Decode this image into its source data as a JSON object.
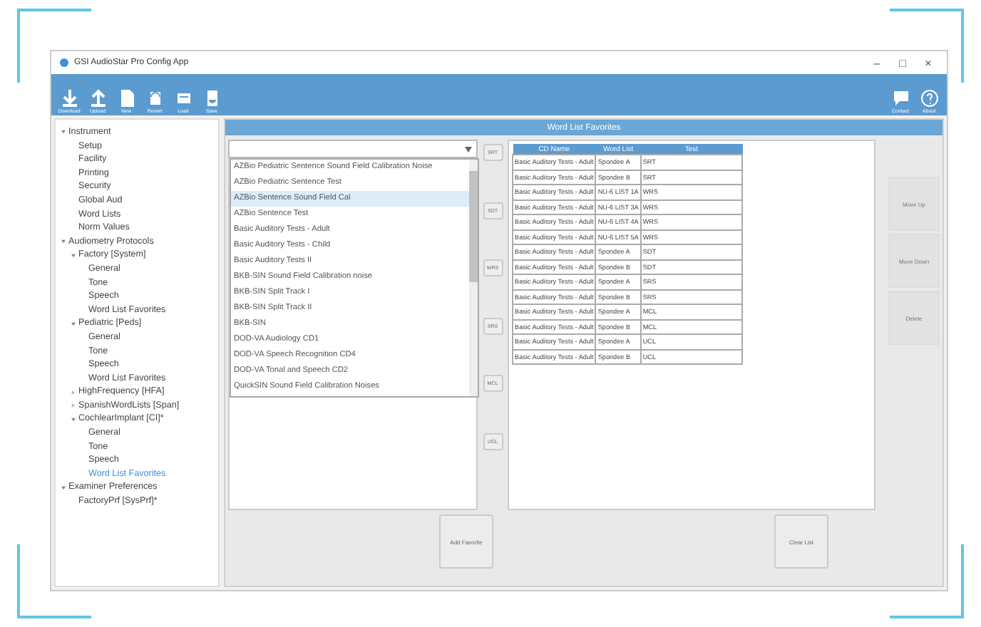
{
  "window": {
    "title": "GSI AudioStar Pro Config App",
    "controls": [
      "–",
      "□",
      "×"
    ]
  },
  "toolbar": {
    "buttons": [
      {
        "label": "Download"
      },
      {
        "label": "Upload"
      },
      {
        "label": "New"
      },
      {
        "label": "Revert"
      },
      {
        "label": "Load"
      },
      {
        "label": "Save"
      }
    ],
    "right_buttons": [
      {
        "label": "Contact"
      },
      {
        "label": "About"
      }
    ]
  },
  "sidebar": {
    "tree": [
      {
        "label": "Instrument",
        "expanded": true,
        "selected": false,
        "children": [
          {
            "label": "Setup",
            "selected": false
          },
          {
            "label": "Facility",
            "selected": false
          },
          {
            "label": "Printing",
            "selected": false
          },
          {
            "label": "Security",
            "selected": false
          },
          {
            "label": "Global Aud",
            "selected": false
          },
          {
            "label": "Word Lists",
            "selected": false
          },
          {
            "label": "Norm Values",
            "selected": false
          }
        ]
      },
      {
        "label": "Audiometry Protocols",
        "expanded": true,
        "selected": false,
        "children": [
          {
            "label": "Factory [System]",
            "expanded": true,
            "selected": false,
            "children": [
              {
                "label": "General",
                "selected": false
              },
              {
                "label": "Tone",
                "selected": false
              },
              {
                "label": "Speech",
                "selected": false
              },
              {
                "label": "Word List Favorites",
                "selected": false
              }
            ]
          },
          {
            "label": "Pediatric [Peds]",
            "expanded": true,
            "selected": false,
            "children": [
              {
                "label": "General",
                "selected": false
              },
              {
                "label": "Tone",
                "selected": false
              },
              {
                "label": "Speech",
                "selected": false
              },
              {
                "label": "Word List Favorites",
                "selected": false
              }
            ]
          },
          {
            "label": "HighFrequency [HFA]",
            "expanded": false,
            "selected": false
          },
          {
            "label": "SpanishWordLists [Span]",
            "expanded": false,
            "selected": false
          },
          {
            "label": "CochlearImplant [CI]*",
            "expanded": true,
            "selected": false,
            "children": [
              {
                "label": "General",
                "selected": false
              },
              {
                "label": "Tone",
                "selected": false
              },
              {
                "label": "Speech",
                "selected": false
              },
              {
                "label": "Word List Favorites",
                "selected": true
              }
            ]
          }
        ]
      },
      {
        "label": "Examiner Preferences",
        "expanded": true,
        "selected": false,
        "children": [
          {
            "label": "FactoryPrf [SysPrf]*",
            "selected": false
          }
        ]
      }
    ]
  },
  "panel": {
    "title": "Word List Favorites",
    "dropdown": {
      "items": [
        {
          "label": "AZBio Pediatric Sentence Sound Field Calibration Noise",
          "selected": false
        },
        {
          "label": "AZBio Pediatric Sentence Test",
          "selected": false
        },
        {
          "label": "AZBio Sentence Sound Field Cal",
          "selected": true
        },
        {
          "label": "AZBio Sentence Test",
          "selected": false
        },
        {
          "label": "Basic Auditory Tests - Adult",
          "selected": false
        },
        {
          "label": "Basic Auditory Tests - Child",
          "selected": false
        },
        {
          "label": "Basic Auditory Tests II",
          "selected": false
        },
        {
          "label": "BKB-SIN Sound Field Calibration noise",
          "selected": false
        },
        {
          "label": "BKB-SIN Split Track I",
          "selected": false
        },
        {
          "label": "BKB-SIN Split Track II",
          "selected": false
        },
        {
          "label": "BKB-SIN",
          "selected": false
        },
        {
          "label": "DOD-VA Audiology CD1",
          "selected": false
        },
        {
          "label": "DOD-VA Speech Recognition CD4",
          "selected": false
        },
        {
          "label": "DOD-VA Tonal and Speech CD2",
          "selected": false
        },
        {
          "label": "QuickSIN Sound Field Calibration Noises",
          "selected": false
        }
      ]
    },
    "test_buttons": [
      "SRT",
      "SDT",
      "WRS",
      "SRS",
      "MCL",
      "UCL"
    ],
    "table": {
      "columns": [
        "CD Name",
        "Word List",
        "Test"
      ],
      "rows": [
        [
          "Basic Auditory Tests - Adult",
          "Spondee A",
          "SRT"
        ],
        [
          "Basic Auditory Tests - Adult",
          "Spondee B",
          "SRT"
        ],
        [
          "Basic Auditory Tests - Adult",
          "NU-6 LIST 1A",
          "WRS"
        ],
        [
          "Basic Auditory Tests - Adult",
          "NU-6 LIST 3A",
          "WRS"
        ],
        [
          "Basic Auditory Tests - Adult",
          "NU-6 LIST 4A",
          "WRS"
        ],
        [
          "Basic Auditory Tests - Adult",
          "NU-6 LIST 5A",
          "WRS"
        ],
        [
          "Basic Auditory Tests - Adult",
          "Spondee A",
          "SDT"
        ],
        [
          "Basic Auditory Tests - Adult",
          "Spondee B",
          "SDT"
        ],
        [
          "Basic Auditory Tests - Adult",
          "Spondee A",
          "SRS"
        ],
        [
          "Basic Auditory Tests - Adult",
          "Spondee B",
          "SRS"
        ],
        [
          "Basic Auditory Tests - Adult",
          "Spondee A",
          "MCL"
        ],
        [
          "Basic Auditory Tests - Adult",
          "Spondee B",
          "MCL"
        ],
        [
          "Basic Auditory Tests - Adult",
          "Spondee A",
          "UCL"
        ],
        [
          "Basic Auditory Tests - Adult",
          "Spondee B",
          "UCL"
        ]
      ]
    },
    "side_buttons": [
      "Move Up",
      "Move Down",
      "Delete"
    ],
    "add_button": "Add Favorite",
    "clear_button": "Clear List"
  }
}
